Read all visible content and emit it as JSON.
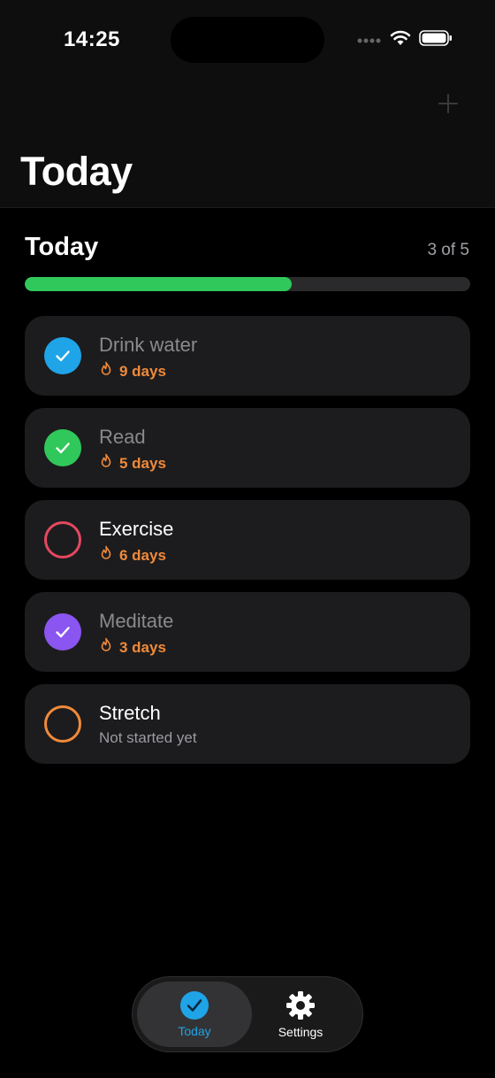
{
  "status_bar": {
    "time": "14:25"
  },
  "header": {
    "large_title": "Today",
    "add_icon": "plus-icon"
  },
  "progress": {
    "title": "Today",
    "count_text": "3 of 5",
    "completed": 3,
    "total": 5,
    "fraction": 0.6,
    "color": "#30c85a"
  },
  "habits": [
    {
      "name": "Drink water",
      "detail": "9 days",
      "done": true,
      "color": "#1fa4e8",
      "icon": "flame-icon"
    },
    {
      "name": "Read",
      "detail": "5 days",
      "done": true,
      "color": "#30c85a",
      "icon": "flame-icon"
    },
    {
      "name": "Exercise",
      "detail": "6 days",
      "done": false,
      "color": "#e4485f",
      "icon": "flame-icon"
    },
    {
      "name": "Meditate",
      "detail": "3 days",
      "done": true,
      "color": "#8a55f0",
      "icon": "flame-icon"
    },
    {
      "name": "Stretch",
      "detail": "Not started yet",
      "done": false,
      "color": "#f08a3a",
      "icon": null
    }
  ],
  "tabbar": {
    "today_label": "Today",
    "settings_label": "Settings",
    "active_color": "#1fa4e8"
  }
}
